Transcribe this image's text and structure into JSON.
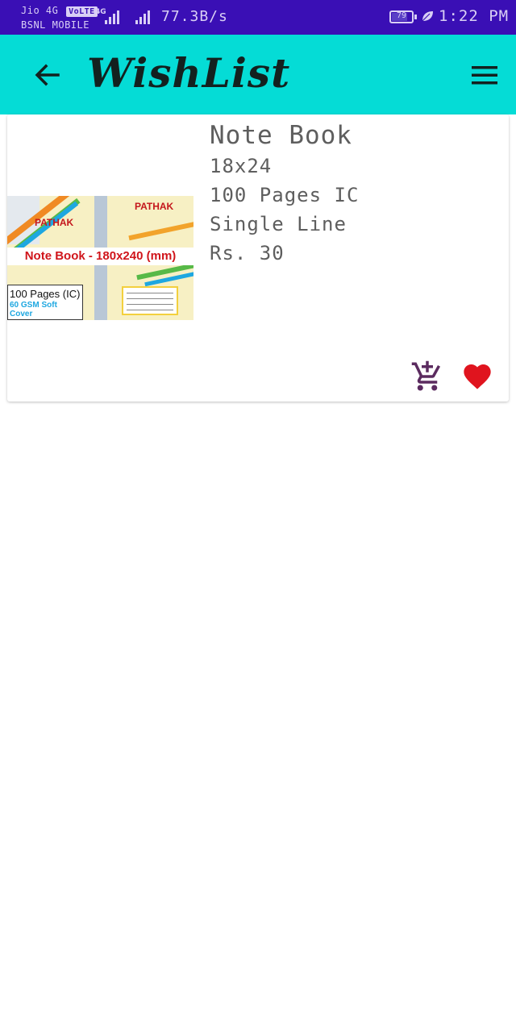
{
  "status_bar": {
    "carrier_top": "Jio 4G",
    "volte": "VoLTE",
    "carrier_bottom": "BSNL MOBILE",
    "network_tag": "4G",
    "speed": "77.3B/s",
    "battery": "79",
    "time": "1:22 PM",
    "battery_level": 0.79
  },
  "app_bar": {
    "title": "WishList",
    "back_icon": "arrow-left-icon",
    "menu_icon": "hamburger-menu-icon",
    "color": "#05dcd6"
  },
  "wishlist": {
    "items": [
      {
        "name": "Note Book",
        "size": "18x24",
        "pages": "100 Pages IC",
        "ruling": "Single Line",
        "price": "Rs. 30",
        "image": {
          "brand": "PATHAK",
          "banner": "Note Book - 180x240 (mm)",
          "pages": "100 Pages (IC)",
          "cover": "60 GSM Soft Cover"
        },
        "actions": {
          "add_to_cart_icon": "add-shopping-cart-icon",
          "favorite_icon": "heart-icon"
        }
      }
    ]
  },
  "colors": {
    "status_bar": "#3a0fb5",
    "cart": "#5b2b5f",
    "heart": "#e0141e"
  }
}
